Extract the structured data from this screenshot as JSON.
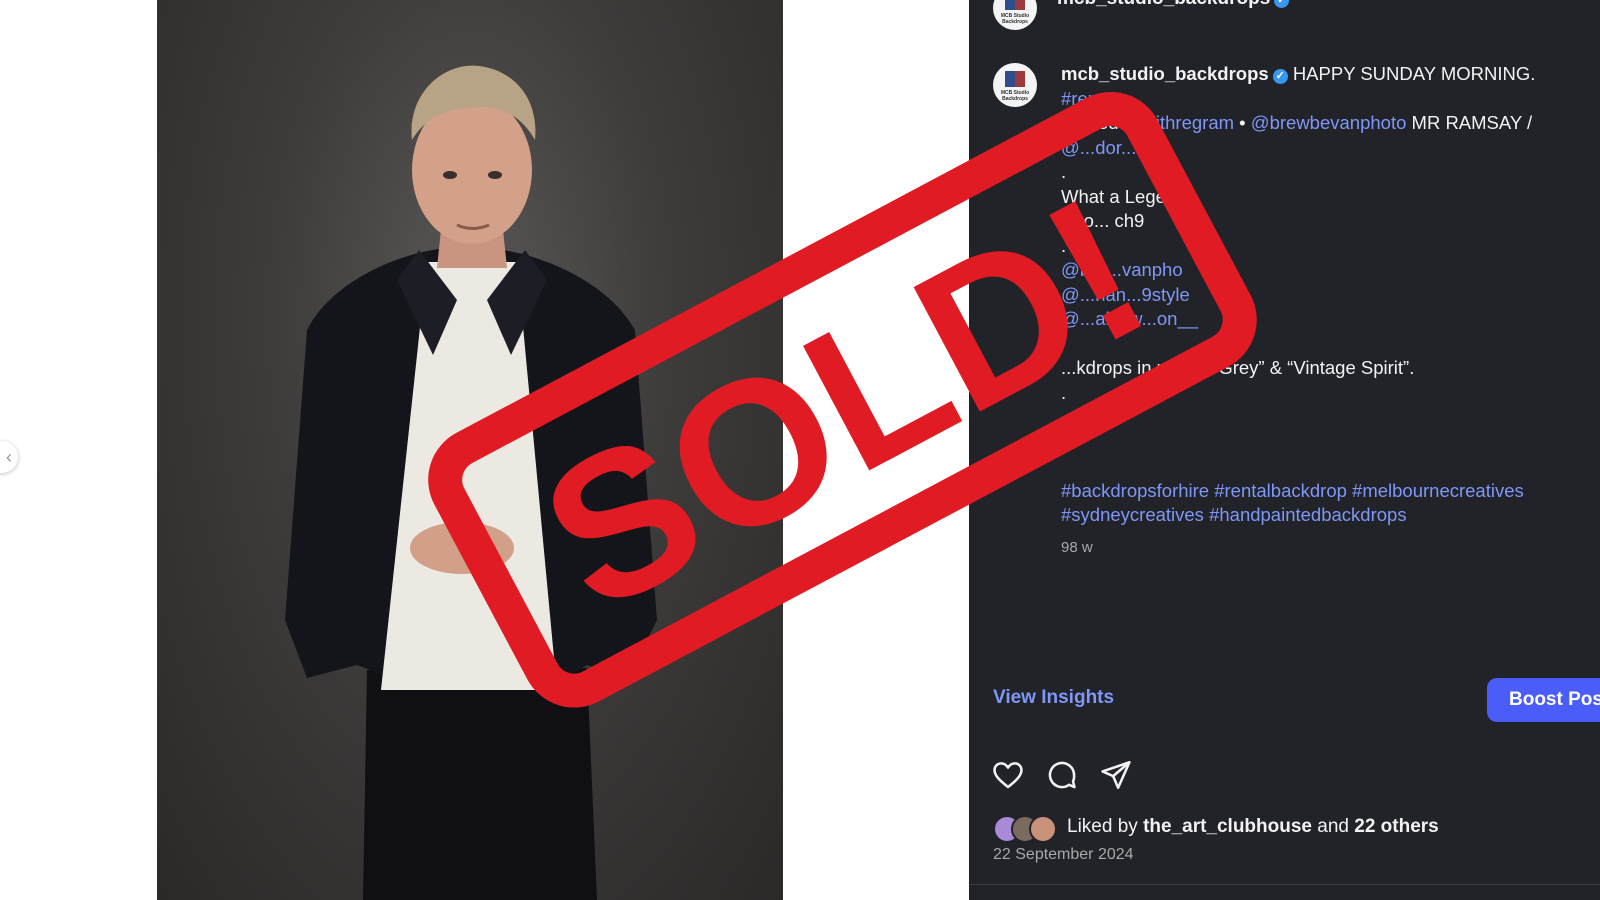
{
  "post": {
    "username": "mcb_studio_backdrops",
    "avatar_text": "MCB Studio Backdrops",
    "verified_mark": "✓",
    "caption": {
      "opening": "HAPPY SUNDAY MORNING.",
      "repost_tag": "#repost",
      "posted_prefix": "Posted",
      "withregram": "@withregram",
      "bullet": "•",
      "brewbevan": "@brewbevanphoto",
      "mr_ramsay": "MR RAMSAY /",
      "obscured_handle": "@...dor...m",
      "dot1": ".",
      "legend_line": "What a Lege...!",
      "shot_line": "Sho... ch9",
      "dot2": ".",
      "handle_1": "@bre...vanpho",
      "handle_2": "@...han...9style",
      "handle_3": "@...alexw...on__",
      "backdrops_line": "...kdrops in use “... Grey” & “Vintage Spirit”.",
      "dot3": ".",
      "dot4": ".",
      "dot5": ".",
      "hashtags_1": "#backdropsforhire #rentalbackdrop #melbournecreatives",
      "hashtags_2": "#sydneycreatives #handpaintedbackdrops"
    },
    "time_ago": "98 w",
    "view_insights": "View Insights",
    "boost_post": "Boost Pos",
    "likes": {
      "prefix": "Liked by",
      "user": "the_art_clubhouse",
      "and": "and",
      "others": "22 others"
    },
    "date": "22 September 2024",
    "stamp_text": "SOLD!",
    "icons": [
      "chevron-left-icon",
      "heart-icon",
      "comment-icon",
      "share-icon"
    ],
    "colors": {
      "panel_bg": "#212329",
      "link": "#7f97f7",
      "boost_button": "#4a5df9",
      "stamp_red": "#e01b24",
      "verified": "#3897f0"
    }
  }
}
